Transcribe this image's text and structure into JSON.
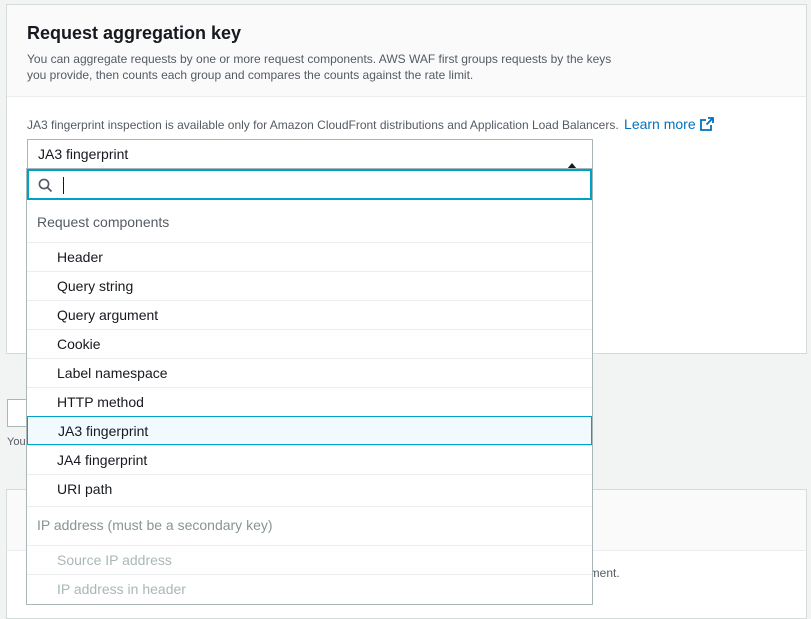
{
  "panel": {
    "title": "Request aggregation key",
    "description": "You can aggregate requests by one or more request components. AWS WAF first groups requests by the keys you provide, then counts each group and compares the counts against the rate limit.",
    "info_text": "JA3 fingerprint inspection is available only for Amazon CloudFront distributions and Application Load Balancers.",
    "learn_more": "Learn more"
  },
  "select": {
    "value": "JA3 fingerprint",
    "search_value": "",
    "search_placeholder": ""
  },
  "dropdown": {
    "group1_label": "Request components",
    "options": [
      "Header",
      "Query string",
      "Query argument",
      "Cookie",
      "Label namespace",
      "HTTP method",
      "JA3 fingerprint",
      "JA4 fingerprint",
      "URI path"
    ],
    "group2_label": "IP address (must be a secondary key)",
    "ip_options": [
      "Source IP address",
      "IP address in header"
    ]
  },
  "background": {
    "helper_prefix": "You",
    "panel2_tail": "ement."
  },
  "colors": {
    "accent": "#0073bb",
    "focus": "#00a1c9"
  }
}
